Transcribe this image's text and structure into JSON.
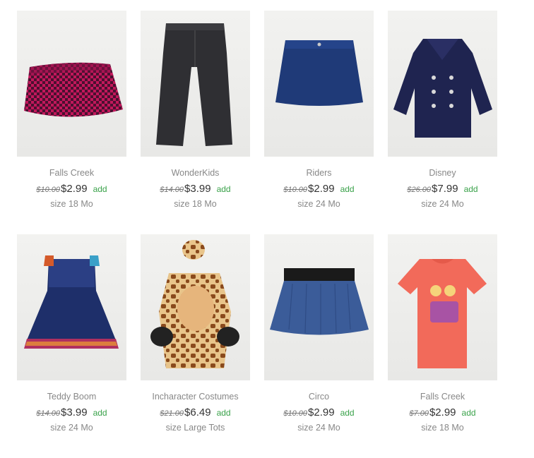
{
  "products": [
    {
      "brand": "Falls Creek",
      "old_price": "$10.00",
      "price": "$2.99",
      "add": "add",
      "size": "size 18 Mo",
      "icon": "pink-houndstooth-skirt"
    },
    {
      "brand": "WonderKids",
      "old_price": "$14.00",
      "price": "$3.99",
      "add": "add",
      "size": "size 18 Mo",
      "icon": "dark-jeans"
    },
    {
      "brand": "Riders",
      "old_price": "$10.00",
      "price": "$2.99",
      "add": "add",
      "size": "size 24 Mo",
      "icon": "denim-skirt"
    },
    {
      "brand": "Disney",
      "old_price": "$26.00",
      "price": "$7.99",
      "add": "add",
      "size": "size 24 Mo",
      "icon": "navy-peacoat"
    },
    {
      "brand": "Teddy Boom",
      "old_price": "$14.00",
      "price": "$3.99",
      "add": "add",
      "size": "size 24 Mo",
      "icon": "denim-dress"
    },
    {
      "brand": "Incharacter Costumes",
      "old_price": "$21.00",
      "price": "$6.49",
      "add": "add",
      "size": "size Large Tots",
      "icon": "giraffe-costume"
    },
    {
      "brand": "Circo",
      "old_price": "$10.00",
      "price": "$2.99",
      "add": "add",
      "size": "size 24 Mo",
      "icon": "chambray-skirt"
    },
    {
      "brand": "Falls Creek",
      "old_price": "$7.00",
      "price": "$2.99",
      "add": "add",
      "size": "size 18 Mo",
      "icon": "coral-tshirt"
    }
  ]
}
